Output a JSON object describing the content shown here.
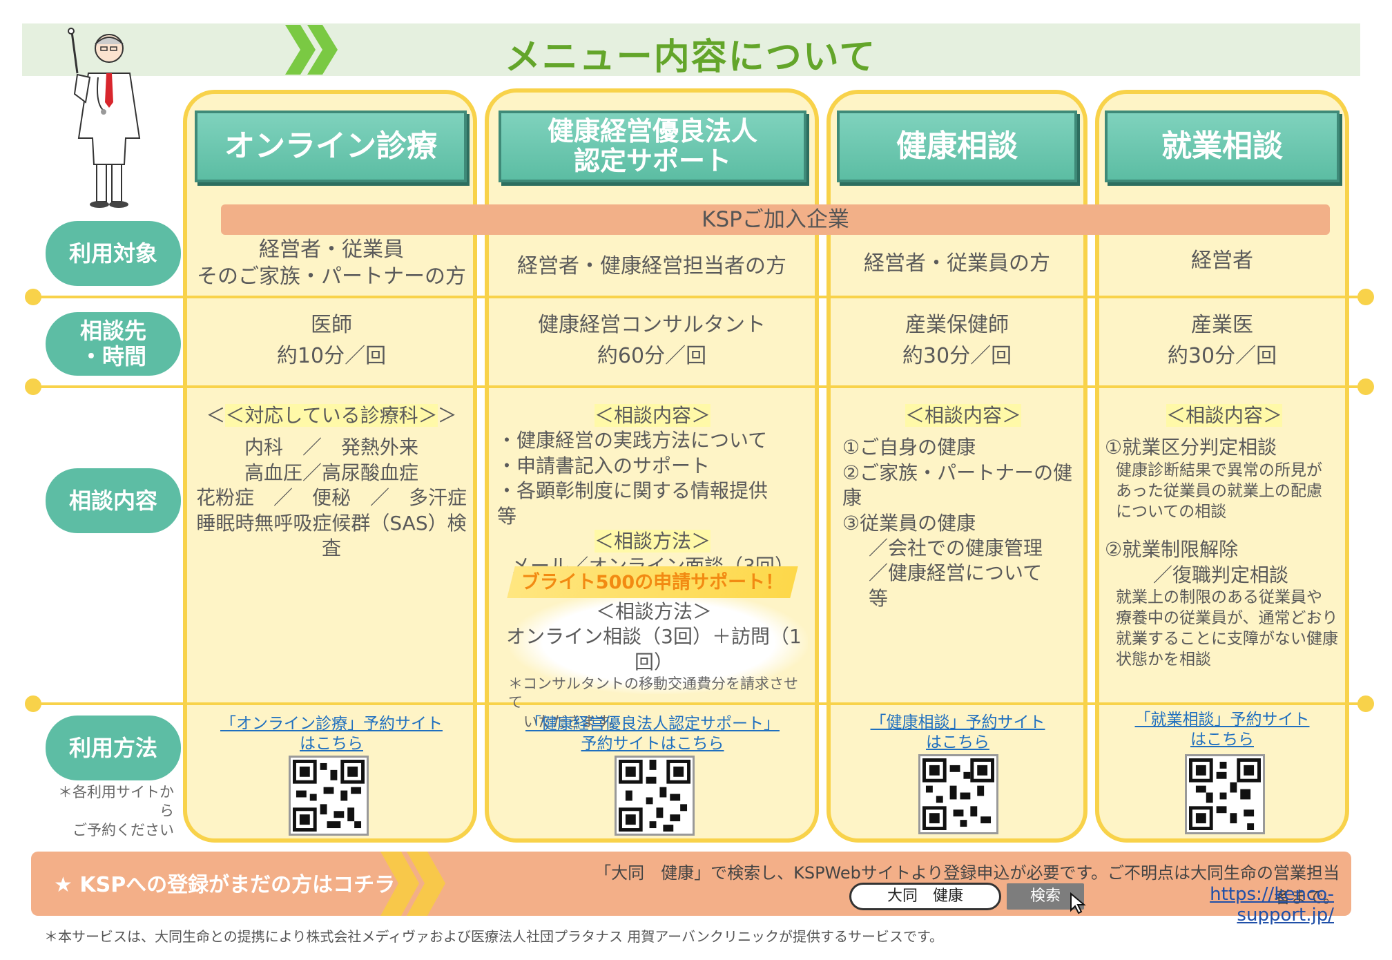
{
  "header": {
    "title": "メニュー内容について"
  },
  "columns": [
    {
      "title": "オンライン診療"
    },
    {
      "title_line1": "健康経営優良法人",
      "title_line2": "認定サポート"
    },
    {
      "title": "健康相談"
    },
    {
      "title": "就業相談"
    }
  ],
  "ksp_bar": "KSPご加入企業",
  "row_labels": {
    "target": "利用対象",
    "consult_line1": "相談先",
    "consult_line2": "・時間",
    "content": "相談内容",
    "usage": "利用方法"
  },
  "usage_note_line1": "＊各利用サイトから",
  "usage_note_line2": "ご予約ください",
  "targets": {
    "c1_line1": "経営者・従業員",
    "c1_line2": "そのご家族・パートナーの方",
    "c2": "経営者・健康経営担当者の方",
    "c3": "経営者・従業員の方",
    "c4": "経営者"
  },
  "consult": {
    "c1_who": "医師",
    "c1_time": "約10分／回",
    "c2_who": "健康経営コンサルタント",
    "c2_time": "約60分／回",
    "c3_who": "産業保健師",
    "c3_time": "約30分／回",
    "c4_who": "産業医",
    "c4_time": "約30分／回"
  },
  "content_c1": {
    "heading": "＜対応している診療科＞",
    "line1": "内科　／　発熱外来",
    "line2": "高血圧／高尿酸血症",
    "line3": "花粉症　／　便秘　／　多汗症",
    "line4": "睡眠時無呼吸症候群（SAS）検査"
  },
  "content_c2": {
    "heading1": "＜相談内容＞",
    "item1": "・健康経営の実践方法について",
    "item2": "・申請書記入のサポート",
    "item3": "・各顕彰制度に関する情報提供　 等",
    "heading2": "＜相談方法＞",
    "method": "メール／オンライン面談（3回）",
    "bright_title": "ブライト500の申請サポート！",
    "heading3": "＜相談方法＞",
    "bright_method": "オンライン相談（3回）＋訪問（1回）",
    "note_line1": "＊コンサルタントの移動交通費分を請求させて",
    "note_line2": "いただきます。"
  },
  "content_c3": {
    "heading": "＜相談内容＞",
    "item1": "①ご自身の健康",
    "item2": "②ご家族・パートナーの健康",
    "item3": "③従業員の健康",
    "sub1": "／会社での健康管理",
    "sub2": "／健康経営について　 等"
  },
  "content_c4": {
    "heading": "＜相談内容＞",
    "item1": "①就業区分判定相談",
    "item1_desc1": "健康診断結果で異常の所見が",
    "item1_desc2": "あった従業員の就業上の配慮",
    "item1_desc3": "についての相談",
    "item2_line1": "②就業制限解除",
    "item2_line2": "／復職判定相談",
    "item2_desc1": "就業上の制限のある従業員や",
    "item2_desc2": "療養中の従業員が、通常どおり",
    "item2_desc3": "就業することに支障がない健康",
    "item2_desc4": "状態かを相談"
  },
  "links": {
    "c1_line1": "「オンライン診療」予約サイト",
    "c1_line2": "はこちら",
    "c2_line1": "「健康経営優良法人認定サポート」",
    "c2_line2": "予約サイトはこちら",
    "c3_line1": "「健康相談」予約サイト",
    "c3_line2": "はこちら",
    "c4_line1": "「就業相談」予約サイト",
    "c4_line2": "はこちら"
  },
  "bottom": {
    "label": "★ KSPへの登録がまだの方はコチラ",
    "note": "「大同　健康」で検索し、KSPWebサイトより登録申込が必要です。ご不明点は大同生命の営業担当者まで。",
    "search_value": "大同　健康",
    "search_button": "検索",
    "url": "https://kenco-support.jp/"
  },
  "footer_note": "＊本サービスは、大同生命との提携により株式会社メディヴァおよび医療法人社団プラタナス 用賀アーバンクリニックが提供するサービスです。",
  "colors": {
    "accent_green": "#63a52a",
    "teal": "#5dbda4",
    "yellow_border": "#f8d24a",
    "cream": "#fef4c6",
    "orange": "#f3af88",
    "bright_orange": "#f28a12",
    "link_blue": "#1f6fbf"
  },
  "icons": [
    "doctor-illustration",
    "chevron-right-icon",
    "qr-code-icon",
    "star-icon",
    "cursor-arrow-icon"
  ]
}
